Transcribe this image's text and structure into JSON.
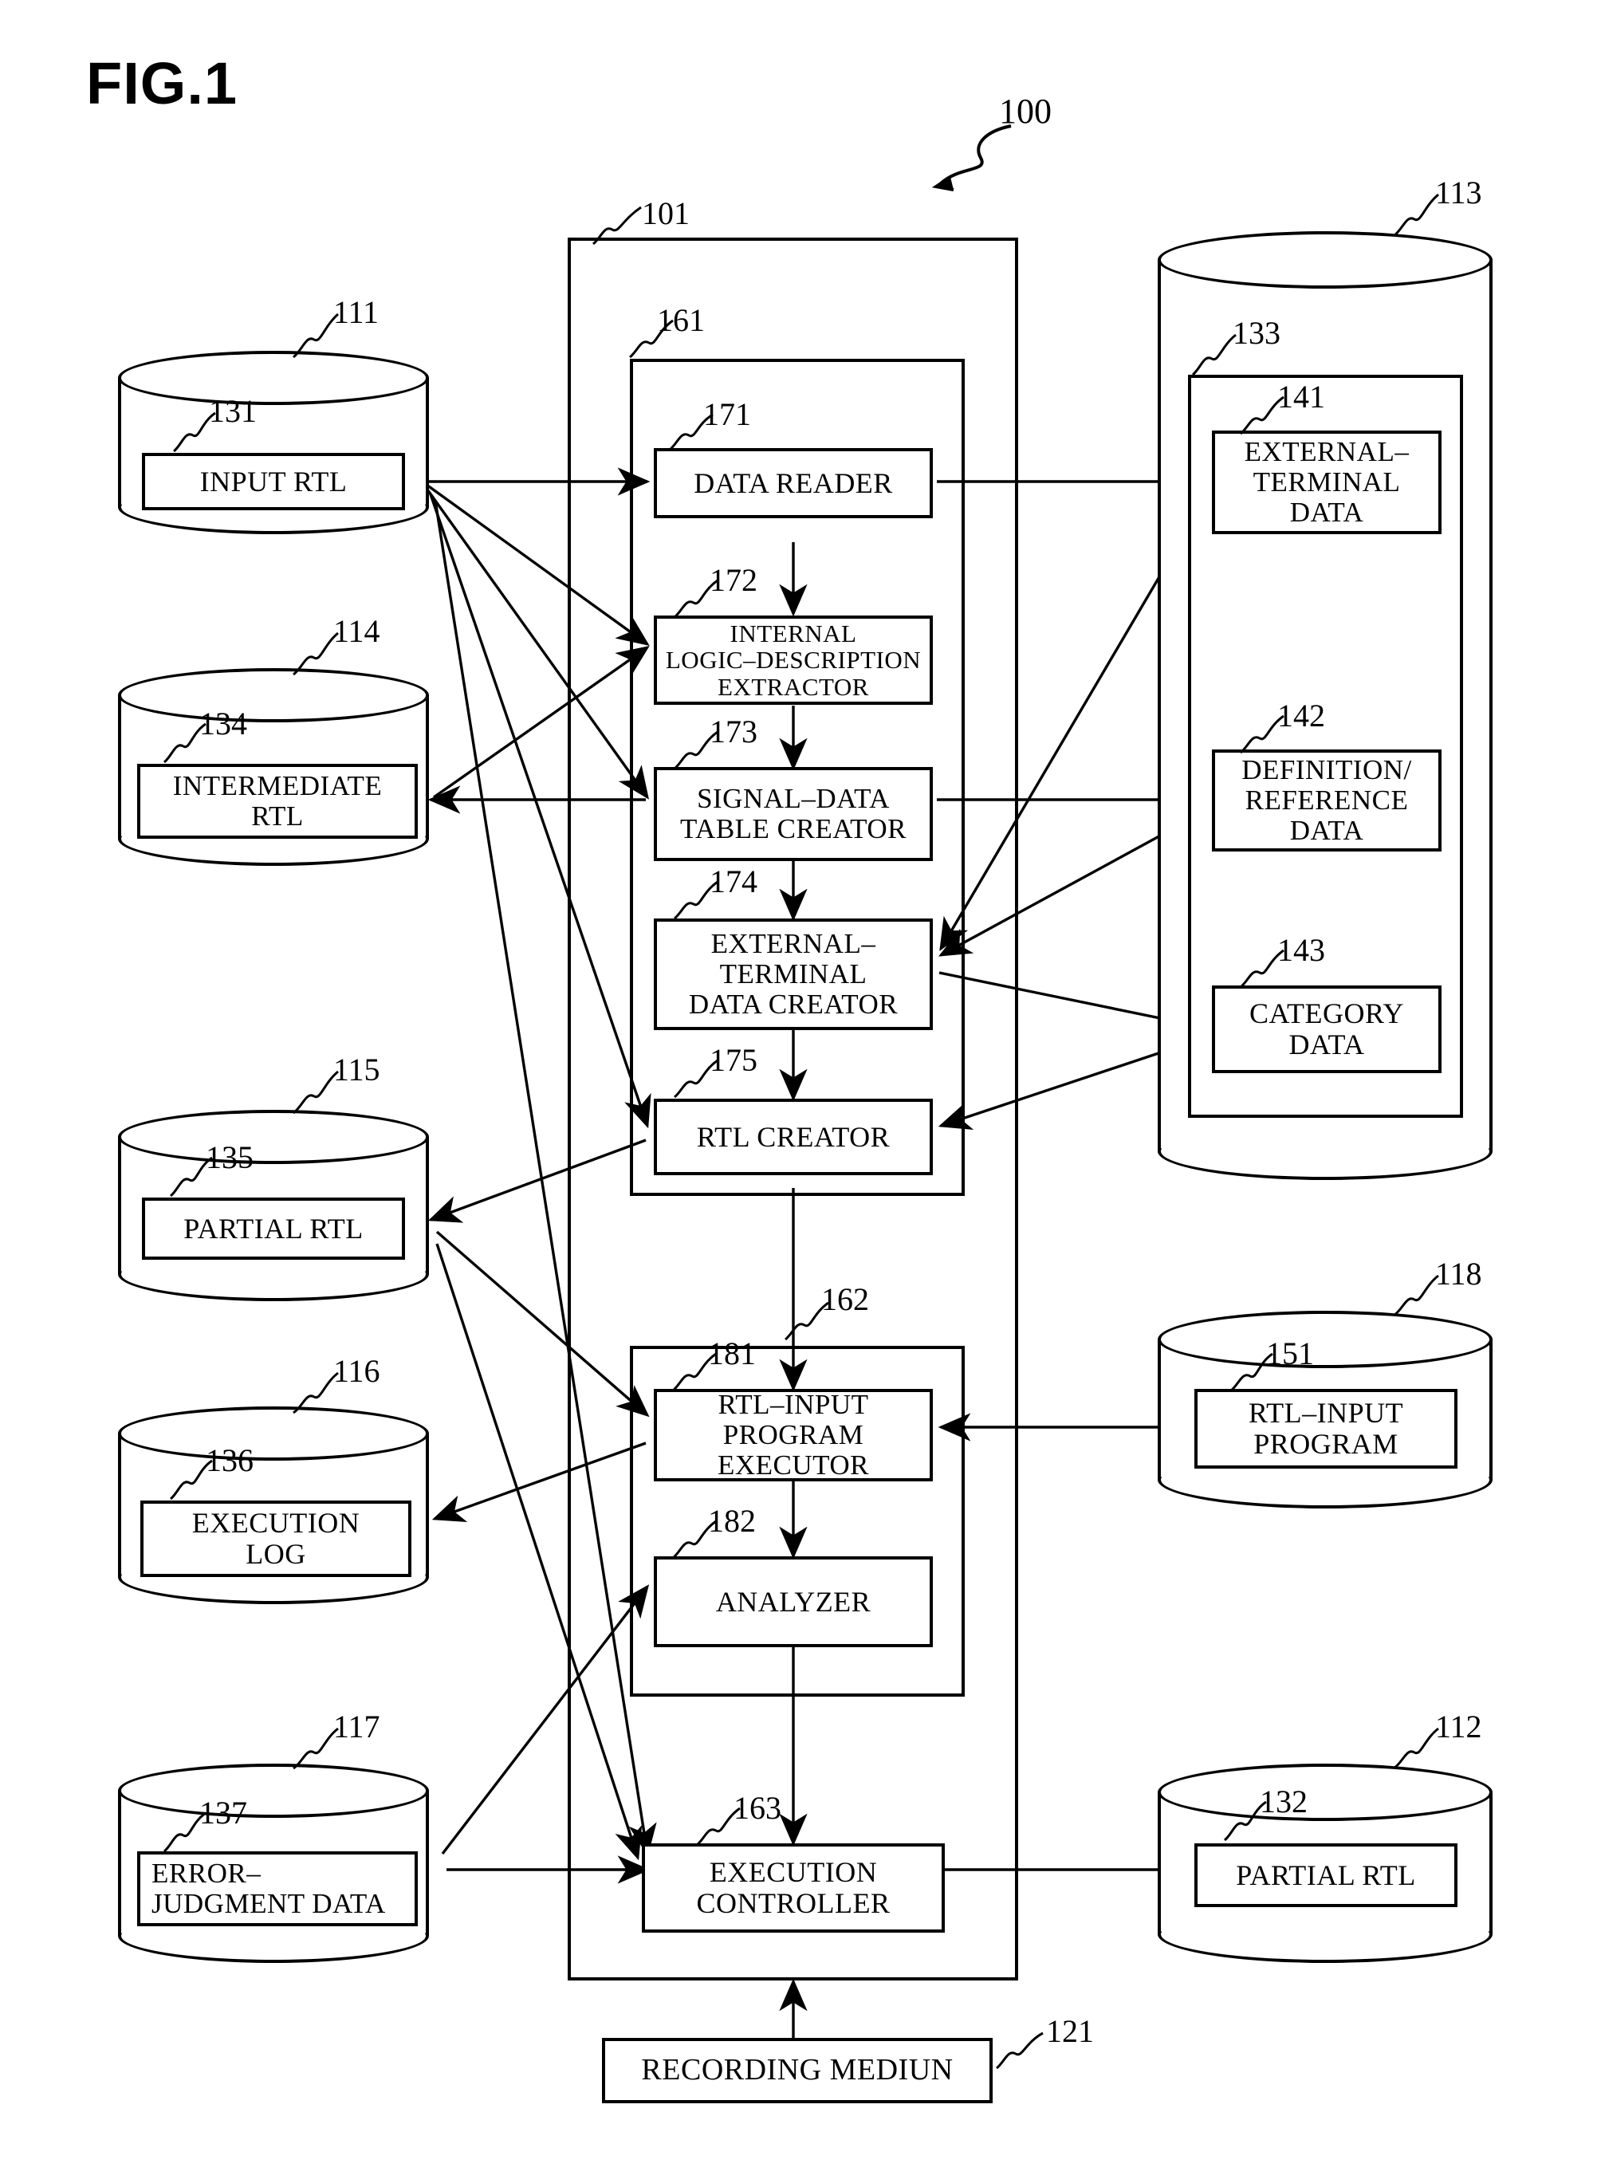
{
  "figure": {
    "title": "FIG.1",
    "system_ref": "100"
  },
  "left_stores": [
    {
      "ref": "111",
      "inner_ref": "131",
      "label": "INPUT RTL",
      "lines": [
        "INPUT RTL"
      ]
    },
    {
      "ref": "114",
      "inner_ref": "134",
      "label": "INTERMEDIATE RTL",
      "lines": [
        "INTERMEDIATE",
        "RTL"
      ]
    },
    {
      "ref": "115",
      "inner_ref": "135",
      "label": "PARTIAL RTL",
      "lines": [
        "PARTIAL RTL"
      ]
    },
    {
      "ref": "116",
      "inner_ref": "136",
      "label": "EXECUTION LOG",
      "lines": [
        "EXECUTION",
        "LOG"
      ]
    },
    {
      "ref": "117",
      "inner_ref": "137",
      "label": "ERROR-JUDGMENT DATA",
      "lines": [
        "ERROR–",
        "JUDGMENT DATA"
      ]
    }
  ],
  "right_stores": [
    {
      "ref": "113",
      "inner_ref": "133",
      "label": "",
      "lines": []
    },
    {
      "ref": "118",
      "inner_ref": "151",
      "label": "RTL-INPUT PROGRAM",
      "lines": [
        "RTL–INPUT",
        "PROGRAM"
      ]
    },
    {
      "ref": "112",
      "inner_ref": "132",
      "label": "PARTIAL RTL",
      "lines": [
        "PARTIAL RTL"
      ]
    }
  ],
  "data_boxes": [
    {
      "ref": "141",
      "label": "EXTERNAL-TERMINAL DATA",
      "lines": [
        "EXTERNAL–",
        "TERMINAL",
        "DATA"
      ]
    },
    {
      "ref": "142",
      "label": "DEFINITION/REFERENCE DATA",
      "lines": [
        "DEFINITION/",
        "REFERENCE",
        "DATA"
      ]
    },
    {
      "ref": "143",
      "label": "CATEGORY DATA",
      "lines": [
        "CATEGORY",
        "DATA"
      ]
    }
  ],
  "main_unit": {
    "ref": "101"
  },
  "creation_unit": {
    "ref": "161",
    "modules": [
      {
        "ref": "171",
        "label": "DATA READER",
        "lines": [
          "DATA READER"
        ]
      },
      {
        "ref": "172",
        "label": "INTERNAL LOGIC-DESCRIPTION EXTRACTOR",
        "lines": [
          "INTERNAL",
          "LOGIC–DESCRIPTION",
          "EXTRACTOR"
        ]
      },
      {
        "ref": "173",
        "label": "SIGNAL-DATA TABLE CREATOR",
        "lines": [
          "SIGNAL–DATA",
          "TABLE CREATOR"
        ]
      },
      {
        "ref": "174",
        "label": "EXTERNAL-TERMINAL DATA CREATOR",
        "lines": [
          "EXTERNAL–",
          "TERMINAL",
          "DATA CREATOR"
        ]
      },
      {
        "ref": "175",
        "label": "RTL CREATOR",
        "lines": [
          "RTL CREATOR"
        ]
      }
    ]
  },
  "execution_unit": {
    "ref": "162",
    "modules": [
      {
        "ref": "181",
        "label": "RTL-INPUT PROGRAM EXECUTOR",
        "lines": [
          "RTL–INPUT",
          "PROGRAM",
          "EXECUTOR"
        ]
      },
      {
        "ref": "182",
        "label": "ANALYZER",
        "lines": [
          "ANALYZER"
        ]
      }
    ]
  },
  "controller": {
    "ref": "163",
    "label": "EXECUTION CONTROLLER",
    "lines": [
      "EXECUTION",
      "CONTROLLER"
    ]
  },
  "recording_medium": {
    "ref": "121",
    "label": "RECORDING MEDIUN",
    "lines": [
      "RECORDING MEDIUN"
    ]
  },
  "colors": {
    "ink": "#000000",
    "paper": "#ffffff"
  }
}
